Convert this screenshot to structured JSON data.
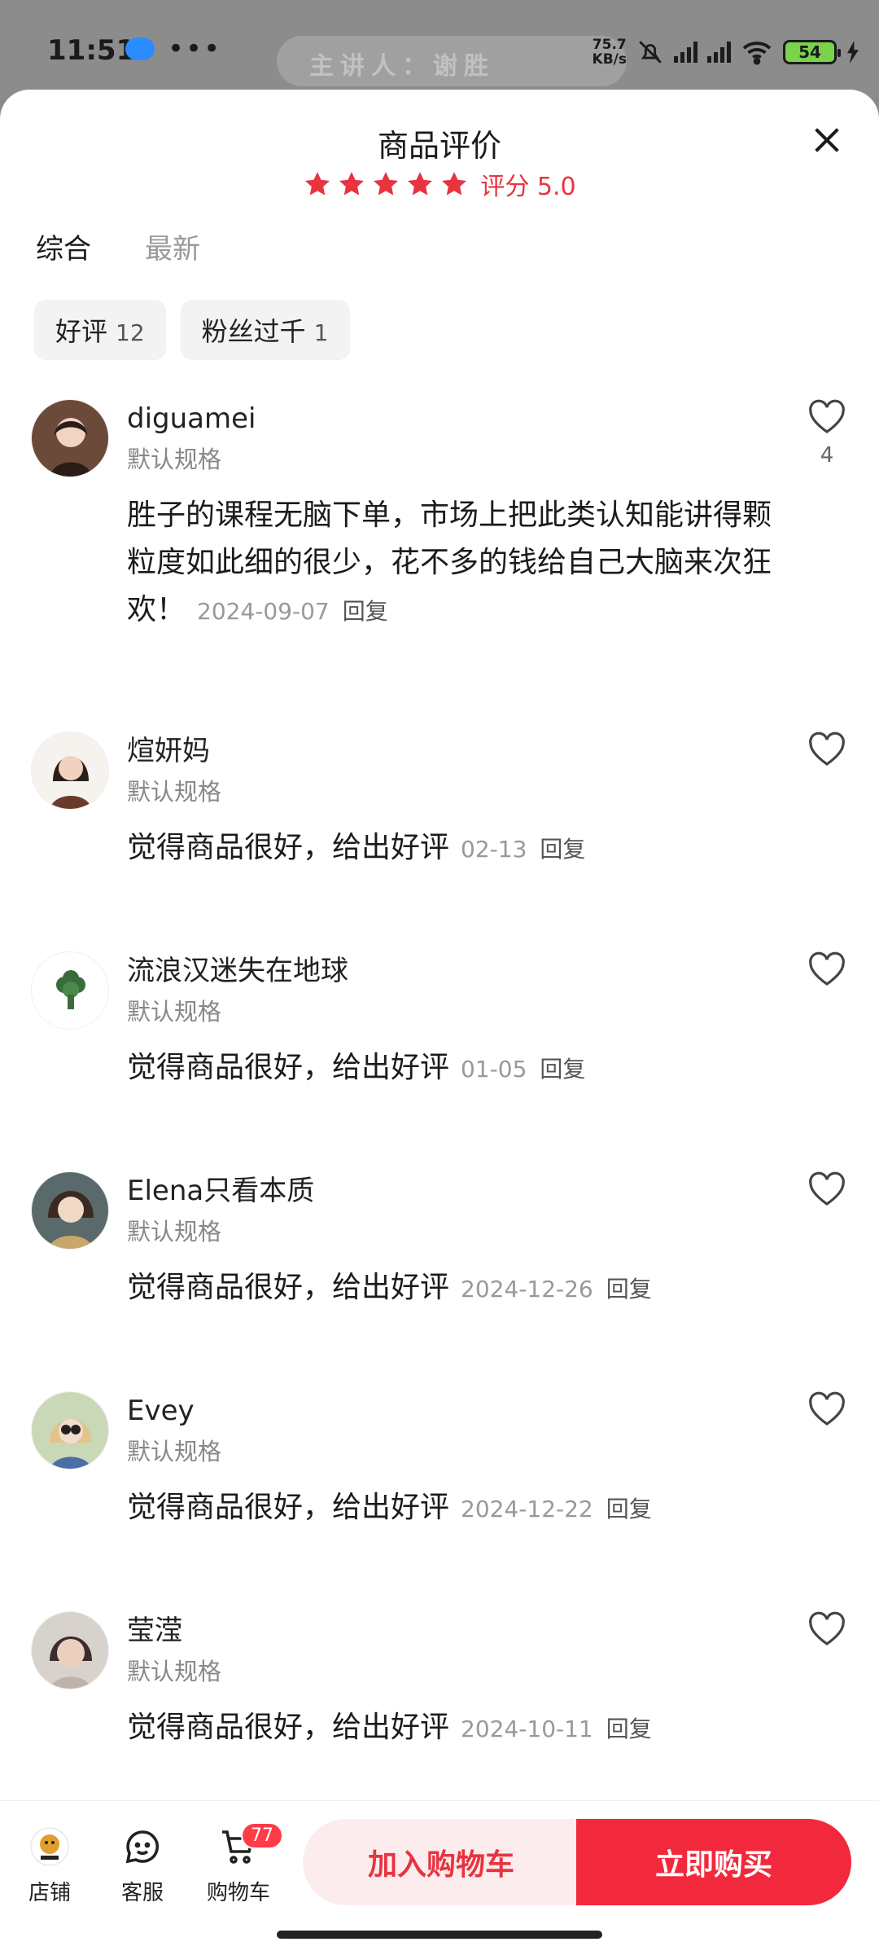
{
  "status_bar": {
    "time": "11:51",
    "dots": "•••",
    "ghost_text": "主讲人：谢胜",
    "speed_top": "75.7",
    "speed_bottom": "KB/s",
    "battery": "54"
  },
  "sheet": {
    "title": "商品评价",
    "rating_label": "评分 5.0",
    "star_count": 5,
    "accent_color": "#e8343f"
  },
  "tabs": [
    {
      "label": "综合",
      "active": true
    },
    {
      "label": "最新",
      "active": false
    }
  ],
  "chips": [
    {
      "label": "好评",
      "count": "12"
    },
    {
      "label": "粉丝过千",
      "count": "1"
    }
  ],
  "reviews": [
    {
      "user": "diguamei",
      "spec": "默认规格",
      "content": "胜子的课程无脑下单，市场上把此类认知能讲得颗粒度如此细的很少，花不多的钱给自己大脑来次狂欢！",
      "date": "2024-09-07",
      "reply": "回复",
      "likes": "4"
    },
    {
      "user": "煊妍妈",
      "spec": "默认规格",
      "content": "觉得商品很好，给出好评",
      "date": "02-13",
      "reply": "回复",
      "likes": ""
    },
    {
      "user": "流浪汉迷失在地球",
      "spec": "默认规格",
      "content": "觉得商品很好，给出好评",
      "date": "01-05",
      "reply": "回复",
      "likes": ""
    },
    {
      "user": "Elena只看本质",
      "spec": "默认规格",
      "content": "觉得商品很好，给出好评",
      "date": "2024-12-26",
      "reply": "回复",
      "likes": ""
    },
    {
      "user": "Evey",
      "spec": "默认规格",
      "content": "觉得商品很好，给出好评",
      "date": "2024-12-22",
      "reply": "回复",
      "likes": ""
    },
    {
      "user": "莹滢",
      "spec": "默认规格",
      "content": "觉得商品很好，给出好评",
      "date": "2024-10-11",
      "reply": "回复",
      "likes": ""
    }
  ],
  "bottom_bar": {
    "store_label": "店铺",
    "service_label": "客服",
    "cart_label": "购物车",
    "cart_badge": "77",
    "add_to_cart": "加入购物车",
    "buy_now": "立即购买"
  }
}
